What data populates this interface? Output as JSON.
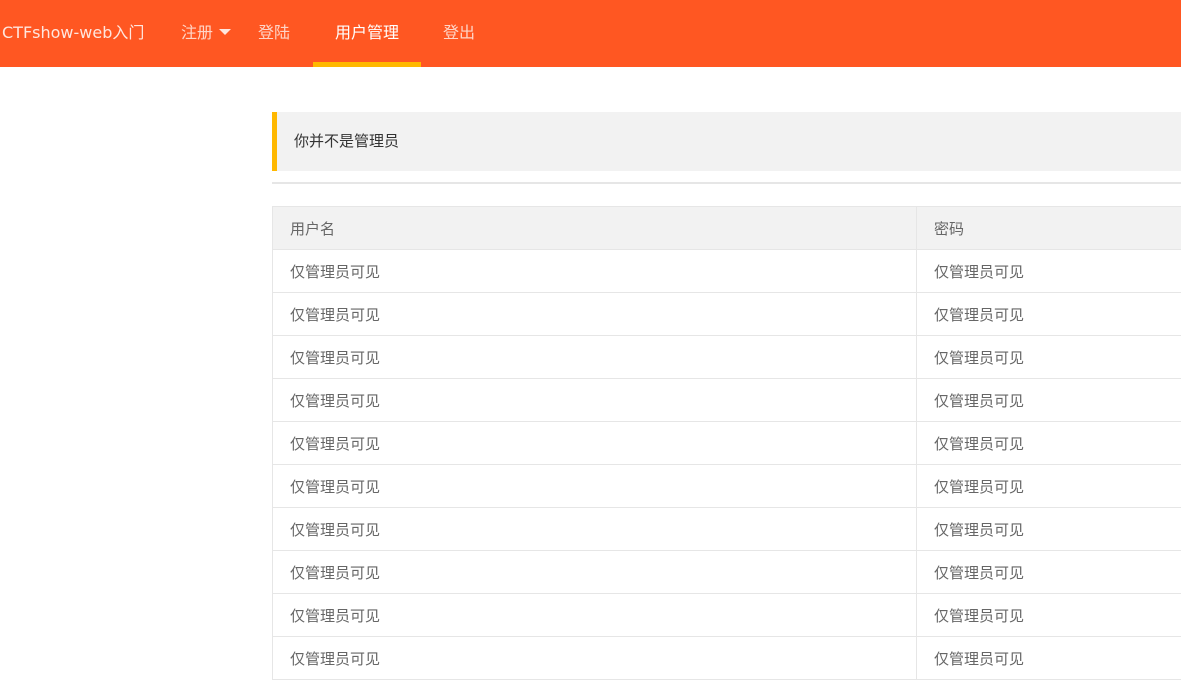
{
  "nav": {
    "brand": "CTFshow-web入门",
    "items": [
      {
        "label": "注册",
        "has_dropdown": true
      },
      {
        "label": "登陆"
      },
      {
        "label": "用户管理",
        "active": true
      },
      {
        "label": "登出"
      }
    ]
  },
  "notice": {
    "text": "你并不是管理员"
  },
  "table": {
    "headers": [
      "用户名",
      "密码"
    ],
    "rows": [
      [
        "仅管理员可见",
        "仅管理员可见"
      ],
      [
        "仅管理员可见",
        "仅管理员可见"
      ],
      [
        "仅管理员可见",
        "仅管理员可见"
      ],
      [
        "仅管理员可见",
        "仅管理员可见"
      ],
      [
        "仅管理员可见",
        "仅管理员可见"
      ],
      [
        "仅管理员可见",
        "仅管理员可见"
      ],
      [
        "仅管理员可见",
        "仅管理员可见"
      ],
      [
        "仅管理员可见",
        "仅管理员可见"
      ],
      [
        "仅管理员可见",
        "仅管理员可见"
      ],
      [
        "仅管理员可见",
        "仅管理员可见"
      ]
    ]
  },
  "colors": {
    "navbar": "#ff5722",
    "accent": "#ffb800",
    "panel": "#f2f2f2",
    "border": "#e6e6e6"
  }
}
